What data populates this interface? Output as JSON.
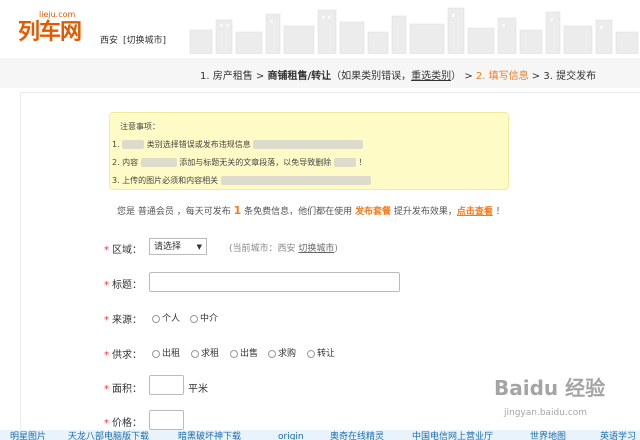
{
  "header": {
    "logo_text": "列车网",
    "logo_domain": "lieju.com",
    "city": "西安",
    "switch_city": "[切换城市]"
  },
  "steps": {
    "step1": "1. 房产租售",
    "sep1": " > ",
    "step2": "商铺租售/转让",
    "step2_note_pre": "（如果类别错误，",
    "step2_note_link": "重选类别",
    "step2_note_post": "）",
    "sep2": " > ",
    "step3": "2. 填写信息",
    "sep3": " > ",
    "step4": "3. 提交发布"
  },
  "notice": {
    "title": "注意事项：",
    "line1": "1.",
    "line1_mid": "类别选择错误或发布违规信息",
    "line2_pre": "2. 内容",
    "line2_post": "添加与标题无关的文章段落，以免导致删除",
    "line2_end": "！",
    "line3": "3. 上传的图片必须和内容相关"
  },
  "member": {
    "pre": "您是 普通会员 ，每天可发布 ",
    "count": "1",
    "mid": " 条免费信息，他们都在使用 ",
    "package": "发布套餐",
    "post": " 提升发布效果，",
    "view": "点击查看",
    "end": " ！"
  },
  "form": {
    "region": {
      "label": "区域：",
      "select": "请选择",
      "hint_pre": "(当前城市：西安  ",
      "hint_link": "切换城市",
      "hint_post": ")"
    },
    "title": {
      "label": "标题："
    },
    "source": {
      "label": "来源：",
      "options": [
        "个人",
        "中介"
      ]
    },
    "supply": {
      "label": "供求：",
      "options": [
        "出租",
        "求租",
        "出售",
        "求购",
        "转让"
      ]
    },
    "area": {
      "label": "面积：",
      "unit": "平米"
    },
    "price": {
      "label": "价格："
    }
  },
  "bottom_links": [
    "明星图片",
    "天龙八部电脑版下载",
    "暗黑破坏神下载",
    "origin",
    "奥奇在线精灵",
    "中国电信网上营业厅",
    "世界地图",
    "英语学习"
  ],
  "watermark": {
    "main": "Baidu 经验",
    "sub": "jingyan.baidu.com"
  },
  "colors": {
    "accent": "#f37b1d",
    "required": "#e33333",
    "notice_bg": "#fffbc6",
    "logo": "#e25a00"
  }
}
